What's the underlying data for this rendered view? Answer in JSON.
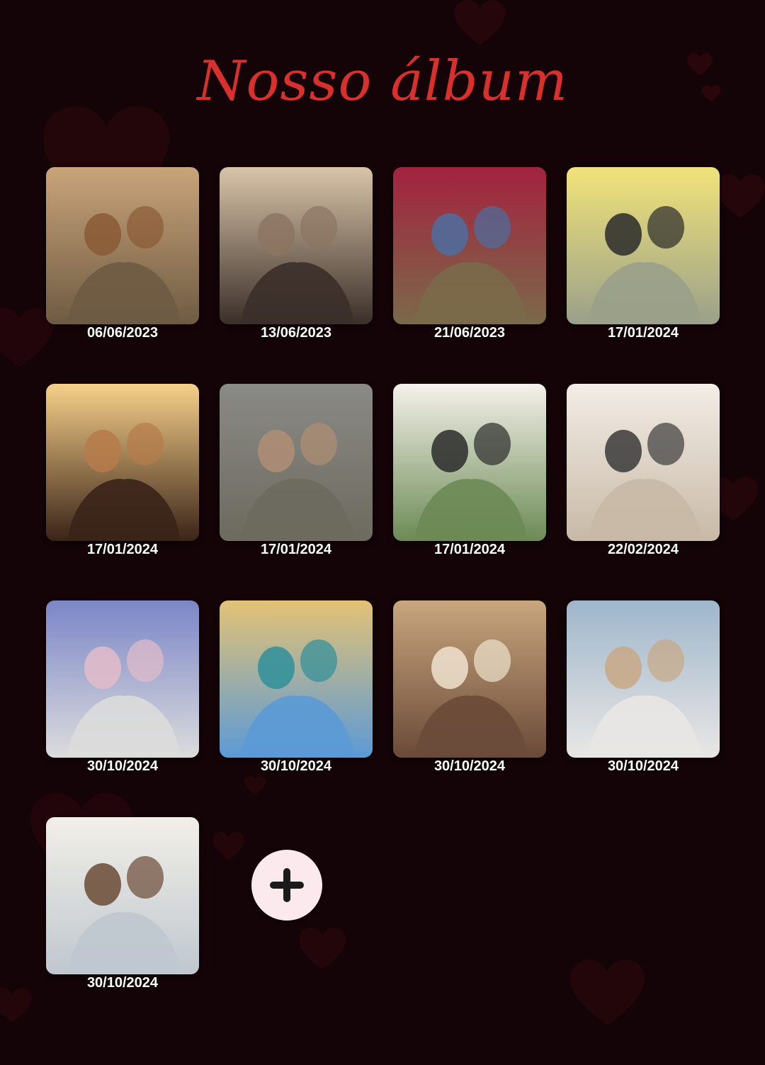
{
  "title": "Nosso álbum",
  "colors": {
    "background": "#140407",
    "title": "#d8302d",
    "date_text": "#ffffff",
    "add_button_bg": "#fbe9ee",
    "add_button_icon": "#1a1a1a"
  },
  "photos": [
    {
      "date": "06/06/2023",
      "scene": "couple-embrace-outdoors",
      "palette": [
        "#6e5b43",
        "#c9a47a",
        "#8a5a35"
      ]
    },
    {
      "date": "13/06/2023",
      "scene": "couple-kiss-string-lights",
      "palette": [
        "#3b2f2a",
        "#d8c4a8",
        "#8c7562"
      ]
    },
    {
      "date": "21/06/2023",
      "scene": "couple-hug-autumn-park",
      "palette": [
        "#7a6a4a",
        "#a3223e",
        "#4c6fa0"
      ]
    },
    {
      "date": "17/01/2024",
      "scene": "couple-selfie-street",
      "palette": [
        "#9aa08a",
        "#f1e37a",
        "#2a2a2a"
      ]
    },
    {
      "date": "17/01/2024",
      "scene": "couple-sunset-kiss",
      "palette": [
        "#3a2418",
        "#f6d08a",
        "#b77a4a"
      ]
    },
    {
      "date": "17/01/2024",
      "scene": "couple-hug-grey-sweaters",
      "palette": [
        "#6d6a5e",
        "#8a8a86",
        "#b08e74"
      ]
    },
    {
      "date": "17/01/2024",
      "scene": "couple-hat-field",
      "palette": [
        "#6c8a55",
        "#f4f1ea",
        "#2b2b2b"
      ]
    },
    {
      "date": "22/02/2024",
      "scene": "couple-embrace-dusk",
      "palette": [
        "#c8b9a6",
        "#f2ede6",
        "#3a3a3a"
      ]
    },
    {
      "date": "30/10/2024",
      "scene": "couple-hug-studio",
      "palette": [
        "#dcdcdc",
        "#7b86c7",
        "#e3bcc9"
      ]
    },
    {
      "date": "30/10/2024",
      "scene": "tropical-beach-palms",
      "palette": [
        "#5b9ad6",
        "#e3c276",
        "#2f8f9a"
      ]
    },
    {
      "date": "30/10/2024",
      "scene": "family-dinner-table",
      "palette": [
        "#6a4a38",
        "#c8a67e",
        "#f0e2cf"
      ]
    },
    {
      "date": "30/10/2024",
      "scene": "couple-carry-beach",
      "palette": [
        "#e9e7e4",
        "#9fb6cc",
        "#c9a885"
      ]
    },
    {
      "date": "30/10/2024",
      "scene": "couple-winter-hug",
      "palette": [
        "#bfc7cf",
        "#f2efe8",
        "#6b4a35"
      ]
    }
  ],
  "add_button": {
    "icon": "plus-icon"
  }
}
